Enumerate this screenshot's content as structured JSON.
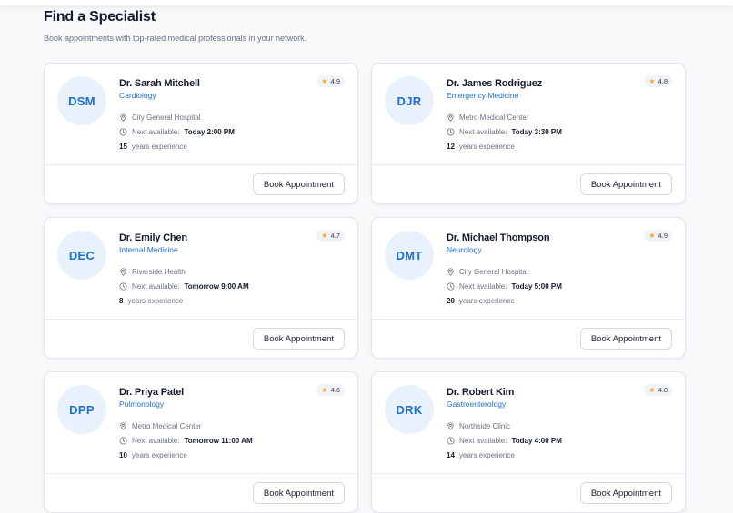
{
  "header": {
    "title": "Find a Specialist",
    "subtitle": "Book appointments with top-rated medical professionals in your network."
  },
  "labels": {
    "next_available": "Next available:",
    "years_experience": "years experience",
    "book_button": "Book Appointment"
  },
  "doctors": [
    {
      "initials": "DSM",
      "name": "Dr. Sarah Mitchell",
      "specialty": "Cardiology",
      "rating": "4.9",
      "location": "City General Hospital",
      "next": "Today 2:00 PM",
      "experience": "15"
    },
    {
      "initials": "DJR",
      "name": "Dr. James Rodriguez",
      "specialty": "Emergency Medicine",
      "rating": "4.8",
      "location": "Metro Medical Center",
      "next": "Today 3:30 PM",
      "experience": "12"
    },
    {
      "initials": "DEC",
      "name": "Dr. Emily Chen",
      "specialty": "Internal Medicine",
      "rating": "4.7",
      "location": "Riverside Health",
      "next": "Tomorrow 9:00 AM",
      "experience": "8"
    },
    {
      "initials": "DMT",
      "name": "Dr. Michael Thompson",
      "specialty": "Neurology",
      "rating": "4.9",
      "location": "City General Hospital",
      "next": "Today 5:00 PM",
      "experience": "20"
    },
    {
      "initials": "DPP",
      "name": "Dr. Priya Patel",
      "specialty": "Pulmonology",
      "rating": "4.6",
      "location": "Metro Medical Center",
      "next": "Tomorrow 11:00 AM",
      "experience": "10"
    },
    {
      "initials": "DRK",
      "name": "Dr. Robert Kim",
      "specialty": "Gastroenterology",
      "rating": "4.8",
      "location": "Northside Clinic",
      "next": "Today 4:00 PM",
      "experience": "14"
    }
  ],
  "colors": {
    "accent": "#1f6fd1",
    "avatar_bg": "#e8f1fc",
    "star": "#f5a524"
  },
  "icons": {
    "location": "map-pin-icon",
    "time": "clock-icon",
    "rating": "star-icon"
  }
}
